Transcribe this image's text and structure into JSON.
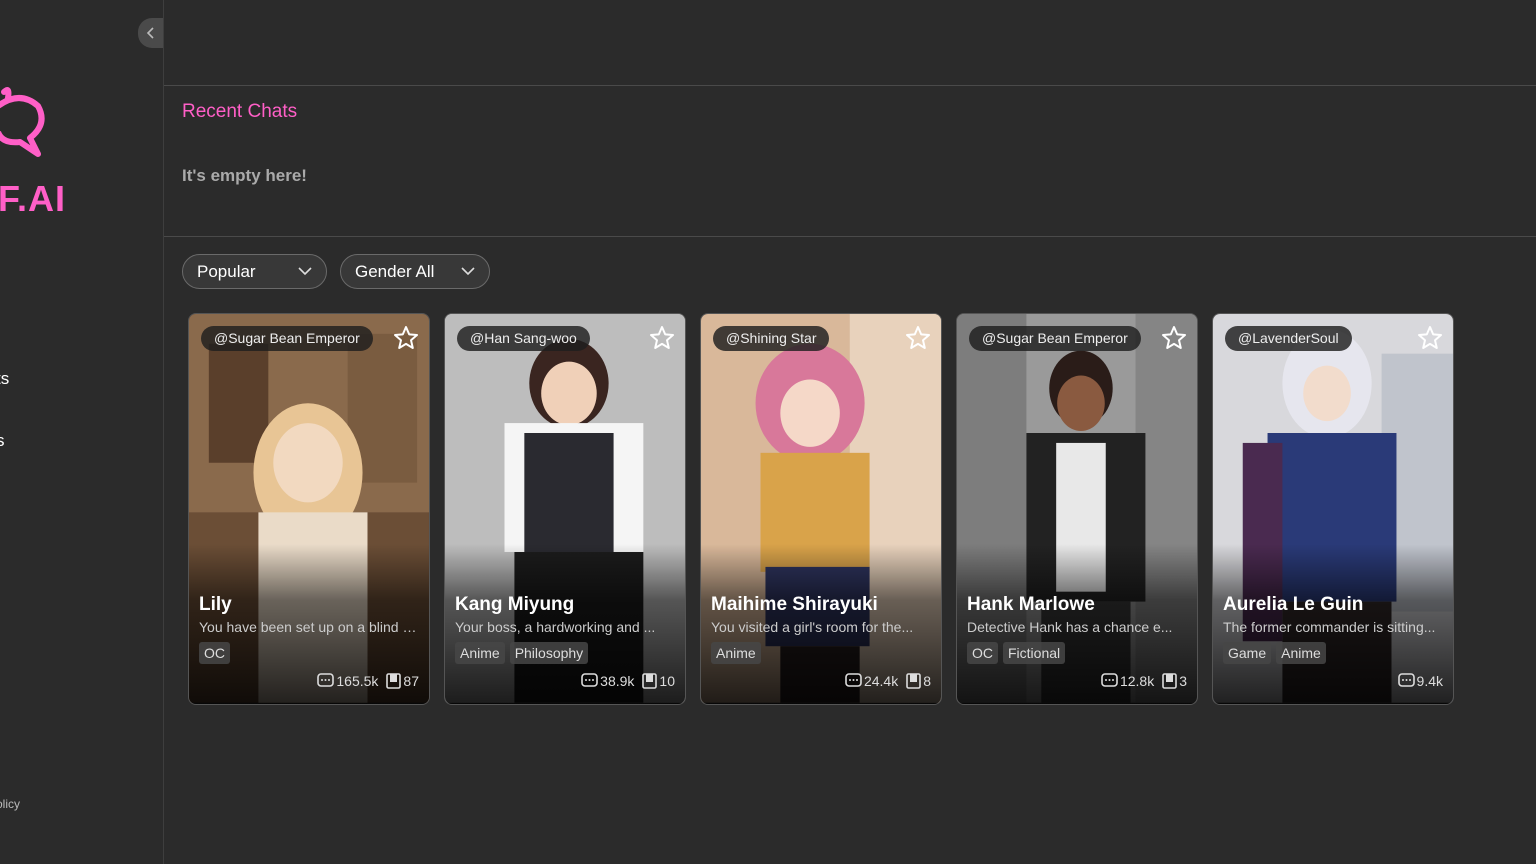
{
  "sidebar": {
    "logo_text": "F.AI",
    "items": [
      {
        "label": "ts"
      },
      {
        "label": "s"
      }
    ],
    "policy": "olicy"
  },
  "colors": {
    "accent": "#ff5fc7",
    "background": "#2b2b2b"
  },
  "recent": {
    "title": "Recent Chats",
    "empty": "It's empty here!"
  },
  "filters": {
    "sort": "Popular",
    "gender": "Gender All"
  },
  "cards": [
    {
      "author": "@Sugar Bean Emperor",
      "name": "Lily",
      "desc": "You have been set up on a blind date...",
      "tags": [
        "OC"
      ],
      "chats": "165.5k",
      "saves": "87"
    },
    {
      "author": "@Han Sang-woo",
      "name": "Kang Miyung",
      "desc": "Your boss, a hardworking and ...",
      "tags": [
        "Anime",
        "Philosophy"
      ],
      "chats": "38.9k",
      "saves": "10"
    },
    {
      "author": "@Shining Star",
      "name": "Maihime Shirayuki",
      "desc": "You visited a girl's room for the...",
      "tags": [
        "Anime"
      ],
      "chats": "24.4k",
      "saves": "8"
    },
    {
      "author": "@Sugar Bean Emperor",
      "name": "Hank Marlowe",
      "desc": "Detective Hank has a chance e...",
      "tags": [
        "OC",
        "Fictional"
      ],
      "chats": "12.8k",
      "saves": "3"
    },
    {
      "author": "@LavenderSoul",
      "name": "Aurelia Le Guin",
      "desc": "The former commander is sitting...",
      "tags": [
        "Game",
        "Anime"
      ],
      "chats": "9.4k",
      "saves": ""
    }
  ]
}
